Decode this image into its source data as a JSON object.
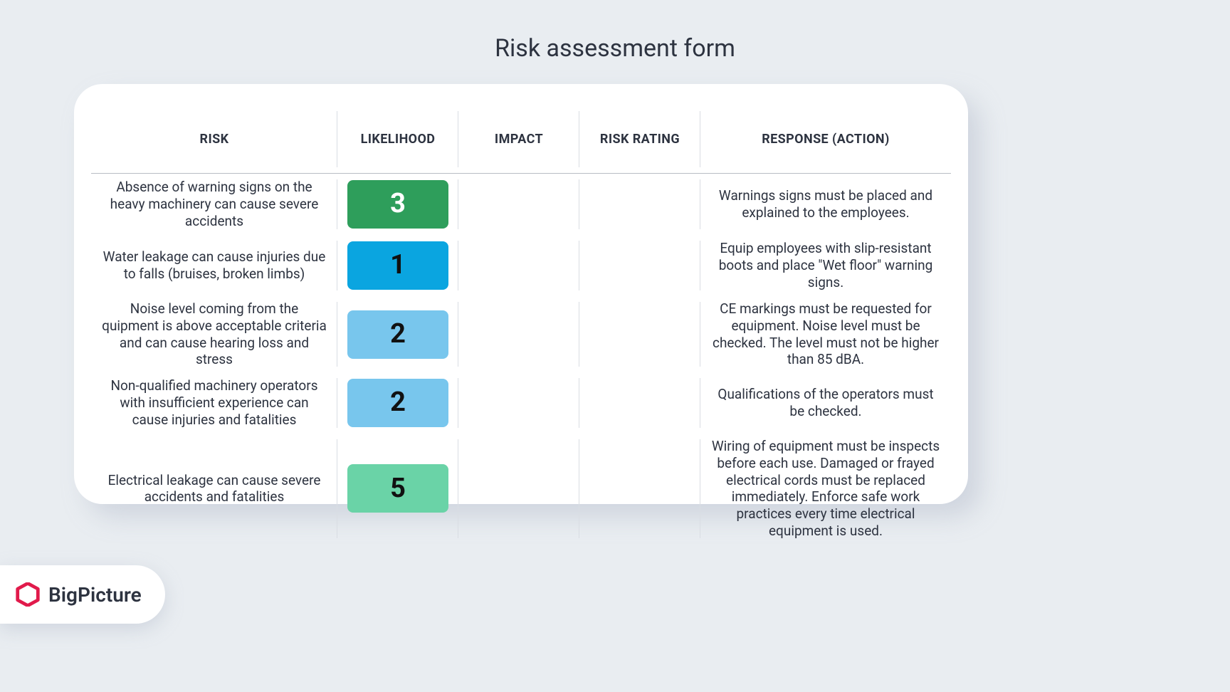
{
  "title": "Risk assessment form",
  "columns": {
    "risk": "RISK",
    "likelihood": "LIKELIHOOD",
    "impact": "IMPACT",
    "rating": "RISK RATING",
    "response": "RESPONSE (ACTION)"
  },
  "rows": [
    {
      "risk": "Absence of warning signs on the heavy machinery can cause severe accidents",
      "likelihood": "3",
      "likelihood_bg": "#2e9e5b",
      "likelihood_fg": "#ffffff",
      "impact": "",
      "rating": "",
      "response": "Warnings signs must be placed and ex­plained to the employees."
    },
    {
      "risk": "Water leakage can cause injuries due to falls (bruises, broken limbs)",
      "likelihood": "1",
      "likelihood_bg": "#0aa5e0",
      "likelihood_fg": "#111111",
      "impact": "",
      "rating": "",
      "response": "Equip employees with slip-resistant boots and place \"Wet floor\" warning signs."
    },
    {
      "risk": "Noise level coming from the quipment is above acceptable criteria and can cause hearing loss and stress",
      "likelihood": "2",
      "likelihood_bg": "#78c6ed",
      "likelihood_fg": "#111111",
      "impact": "",
      "rating": "",
      "response": "CE markings must be requested for equip­ment. Noise level must be checked. The level must not be higher  than 85 dBA."
    },
    {
      "risk": "Non-qualified machinery operators with insufficient experience can cause injuries and fatalities",
      "likelihood": "2",
      "likelihood_bg": "#78c6ed",
      "likelihood_fg": "#111111",
      "impact": "",
      "rating": "",
      "response": "Qualifications of the operators must be checked."
    },
    {
      "risk": "Electrical leakage can cause severe acci­dents and fatalities",
      "likelihood": "5",
      "likelihood_bg": "#6ad3a7",
      "likelihood_fg": "#111111",
      "impact": "",
      "rating": "",
      "response": "Wiring of equipment must be inspects before each use. Damaged or frayed elec­trical cords must be replaced immediately. Enforce safe work practices every time electrical equipment is used."
    }
  ],
  "brand": {
    "name": "BigPicture",
    "accent": "#e11a4b"
  }
}
